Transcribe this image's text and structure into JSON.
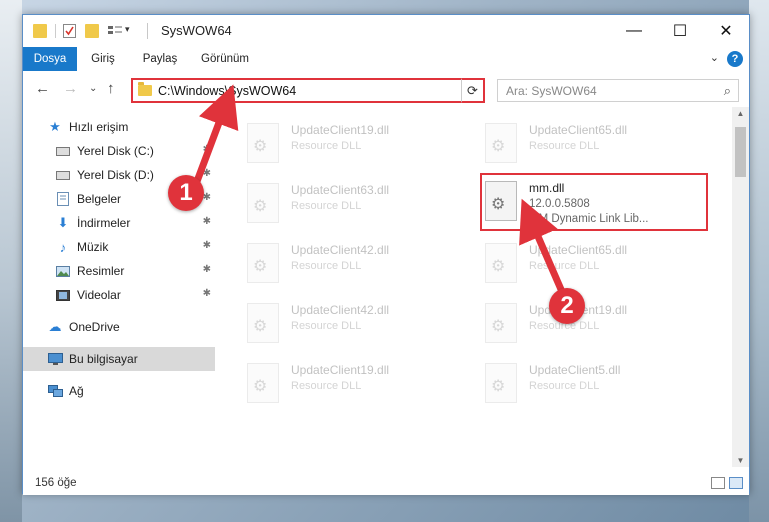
{
  "window": {
    "title": "SysWOW64"
  },
  "tabs": [
    {
      "label": "Dosya",
      "active": true
    },
    {
      "label": "Giriş"
    },
    {
      "label": "Paylaş"
    },
    {
      "label": "Görünüm"
    }
  ],
  "address": {
    "path": "C:\\Windows\\SysWOW64",
    "search_placeholder": "Ara: SysWOW64"
  },
  "sidebar": {
    "items": [
      {
        "label": "Hızlı erişim",
        "icon": "star-icon"
      },
      {
        "label": "Yerel Disk (C:)",
        "icon": "drive-icon",
        "pinned": true
      },
      {
        "label": "Yerel Disk (D:)",
        "icon": "drive-icon",
        "pinned": true
      },
      {
        "label": "Belgeler",
        "icon": "documents-icon",
        "pinned": true
      },
      {
        "label": "İndirmeler",
        "icon": "download-icon",
        "pinned": true
      },
      {
        "label": "Müzik",
        "icon": "music-icon",
        "pinned": true
      },
      {
        "label": "Resimler",
        "icon": "pictures-icon",
        "pinned": true
      },
      {
        "label": "Videolar",
        "icon": "videos-icon",
        "pinned": true
      },
      {
        "label": "OneDrive",
        "icon": "cloud-icon"
      },
      {
        "label": "Bu bilgisayar",
        "icon": "computer-icon",
        "selected": true
      },
      {
        "label": "Ağ",
        "icon": "network-icon"
      }
    ]
  },
  "files": {
    "left": [
      {
        "name": "UpdateClient19.dll",
        "desc": "Resource DLL"
      },
      {
        "name": "UpdateClient63.dll",
        "desc": "Resource DLL"
      },
      {
        "name": "UpdateClient42.dll",
        "desc": "Resource DLL"
      },
      {
        "name": "UpdateClient42.dll",
        "desc": "Resource DLL"
      },
      {
        "name": "UpdateClient19.dll",
        "desc": "Resource DLL"
      }
    ],
    "right": [
      {
        "name": "UpdateClient65.dll",
        "desc": "Resource DLL"
      },
      {
        "name": "mm.dll",
        "desc": "12.0.0.5808",
        "desc2": "MM Dynamic Link Lib...",
        "highlighted": true
      },
      {
        "name": "UpdateClient65.dll",
        "desc": "Resource DLL"
      },
      {
        "name": "UpdateClient19.dll",
        "desc": "Resource DLL"
      },
      {
        "name": "UpdateClient5.dll",
        "desc": "Resource DLL"
      }
    ]
  },
  "status": {
    "item_count": "156 öğe"
  },
  "callouts": {
    "one": "1",
    "two": "2",
    "color": "#e0333b"
  },
  "colors": {
    "accent": "#1979ca",
    "highlight": "#e0333b"
  }
}
